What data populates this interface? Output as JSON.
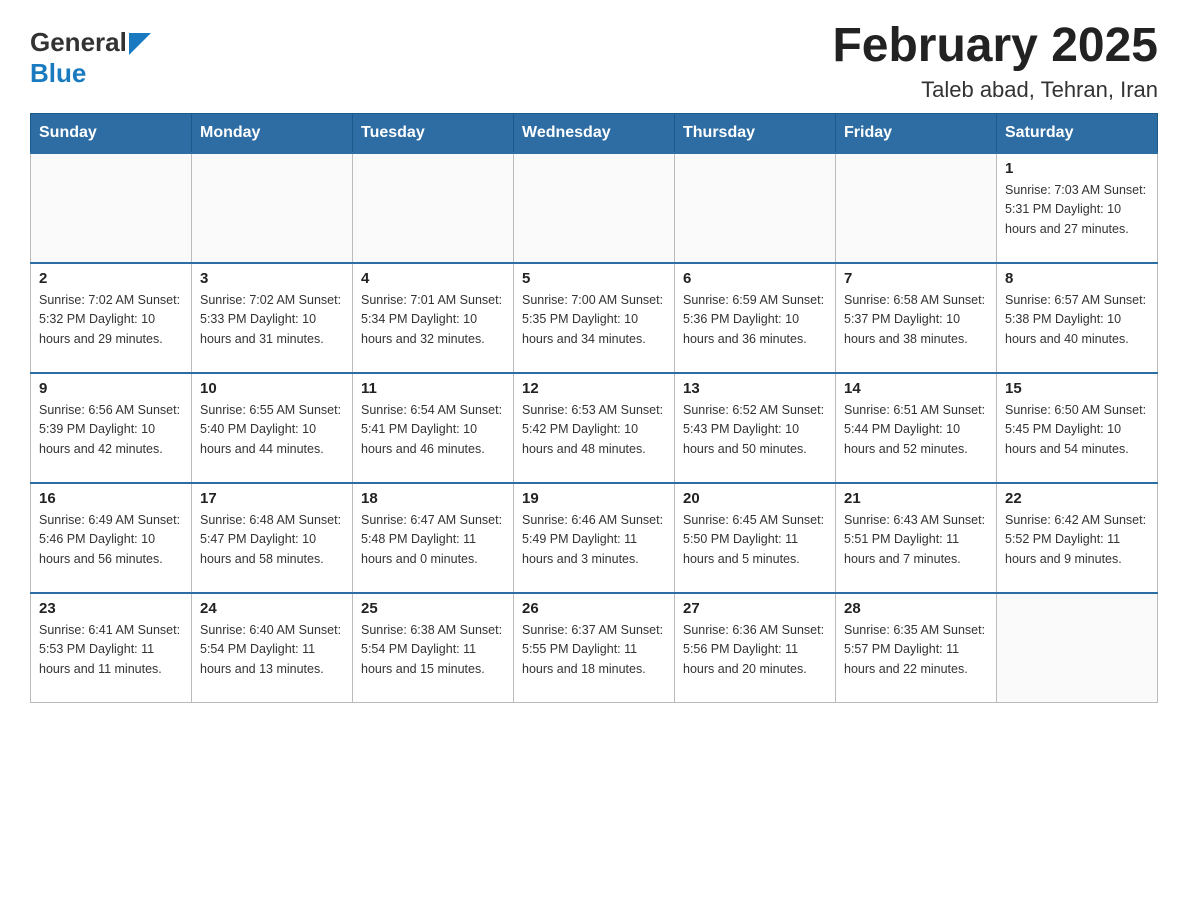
{
  "header": {
    "logo_general": "General",
    "logo_arrow": "▶",
    "logo_blue": "Blue",
    "month": "February 2025",
    "location": "Taleb abad, Tehran, Iran"
  },
  "weekdays": [
    "Sunday",
    "Monday",
    "Tuesday",
    "Wednesday",
    "Thursday",
    "Friday",
    "Saturday"
  ],
  "weeks": [
    [
      {
        "day": "",
        "info": ""
      },
      {
        "day": "",
        "info": ""
      },
      {
        "day": "",
        "info": ""
      },
      {
        "day": "",
        "info": ""
      },
      {
        "day": "",
        "info": ""
      },
      {
        "day": "",
        "info": ""
      },
      {
        "day": "1",
        "info": "Sunrise: 7:03 AM\nSunset: 5:31 PM\nDaylight: 10 hours\nand 27 minutes."
      }
    ],
    [
      {
        "day": "2",
        "info": "Sunrise: 7:02 AM\nSunset: 5:32 PM\nDaylight: 10 hours\nand 29 minutes."
      },
      {
        "day": "3",
        "info": "Sunrise: 7:02 AM\nSunset: 5:33 PM\nDaylight: 10 hours\nand 31 minutes."
      },
      {
        "day": "4",
        "info": "Sunrise: 7:01 AM\nSunset: 5:34 PM\nDaylight: 10 hours\nand 32 minutes."
      },
      {
        "day": "5",
        "info": "Sunrise: 7:00 AM\nSunset: 5:35 PM\nDaylight: 10 hours\nand 34 minutes."
      },
      {
        "day": "6",
        "info": "Sunrise: 6:59 AM\nSunset: 5:36 PM\nDaylight: 10 hours\nand 36 minutes."
      },
      {
        "day": "7",
        "info": "Sunrise: 6:58 AM\nSunset: 5:37 PM\nDaylight: 10 hours\nand 38 minutes."
      },
      {
        "day": "8",
        "info": "Sunrise: 6:57 AM\nSunset: 5:38 PM\nDaylight: 10 hours\nand 40 minutes."
      }
    ],
    [
      {
        "day": "9",
        "info": "Sunrise: 6:56 AM\nSunset: 5:39 PM\nDaylight: 10 hours\nand 42 minutes."
      },
      {
        "day": "10",
        "info": "Sunrise: 6:55 AM\nSunset: 5:40 PM\nDaylight: 10 hours\nand 44 minutes."
      },
      {
        "day": "11",
        "info": "Sunrise: 6:54 AM\nSunset: 5:41 PM\nDaylight: 10 hours\nand 46 minutes."
      },
      {
        "day": "12",
        "info": "Sunrise: 6:53 AM\nSunset: 5:42 PM\nDaylight: 10 hours\nand 48 minutes."
      },
      {
        "day": "13",
        "info": "Sunrise: 6:52 AM\nSunset: 5:43 PM\nDaylight: 10 hours\nand 50 minutes."
      },
      {
        "day": "14",
        "info": "Sunrise: 6:51 AM\nSunset: 5:44 PM\nDaylight: 10 hours\nand 52 minutes."
      },
      {
        "day": "15",
        "info": "Sunrise: 6:50 AM\nSunset: 5:45 PM\nDaylight: 10 hours\nand 54 minutes."
      }
    ],
    [
      {
        "day": "16",
        "info": "Sunrise: 6:49 AM\nSunset: 5:46 PM\nDaylight: 10 hours\nand 56 minutes."
      },
      {
        "day": "17",
        "info": "Sunrise: 6:48 AM\nSunset: 5:47 PM\nDaylight: 10 hours\nand 58 minutes."
      },
      {
        "day": "18",
        "info": "Sunrise: 6:47 AM\nSunset: 5:48 PM\nDaylight: 11 hours\nand 0 minutes."
      },
      {
        "day": "19",
        "info": "Sunrise: 6:46 AM\nSunset: 5:49 PM\nDaylight: 11 hours\nand 3 minutes."
      },
      {
        "day": "20",
        "info": "Sunrise: 6:45 AM\nSunset: 5:50 PM\nDaylight: 11 hours\nand 5 minutes."
      },
      {
        "day": "21",
        "info": "Sunrise: 6:43 AM\nSunset: 5:51 PM\nDaylight: 11 hours\nand 7 minutes."
      },
      {
        "day": "22",
        "info": "Sunrise: 6:42 AM\nSunset: 5:52 PM\nDaylight: 11 hours\nand 9 minutes."
      }
    ],
    [
      {
        "day": "23",
        "info": "Sunrise: 6:41 AM\nSunset: 5:53 PM\nDaylight: 11 hours\nand 11 minutes."
      },
      {
        "day": "24",
        "info": "Sunrise: 6:40 AM\nSunset: 5:54 PM\nDaylight: 11 hours\nand 13 minutes."
      },
      {
        "day": "25",
        "info": "Sunrise: 6:38 AM\nSunset: 5:54 PM\nDaylight: 11 hours\nand 15 minutes."
      },
      {
        "day": "26",
        "info": "Sunrise: 6:37 AM\nSunset: 5:55 PM\nDaylight: 11 hours\nand 18 minutes."
      },
      {
        "day": "27",
        "info": "Sunrise: 6:36 AM\nSunset: 5:56 PM\nDaylight: 11 hours\nand 20 minutes."
      },
      {
        "day": "28",
        "info": "Sunrise: 6:35 AM\nSunset: 5:57 PM\nDaylight: 11 hours\nand 22 minutes."
      },
      {
        "day": "",
        "info": ""
      }
    ]
  ]
}
